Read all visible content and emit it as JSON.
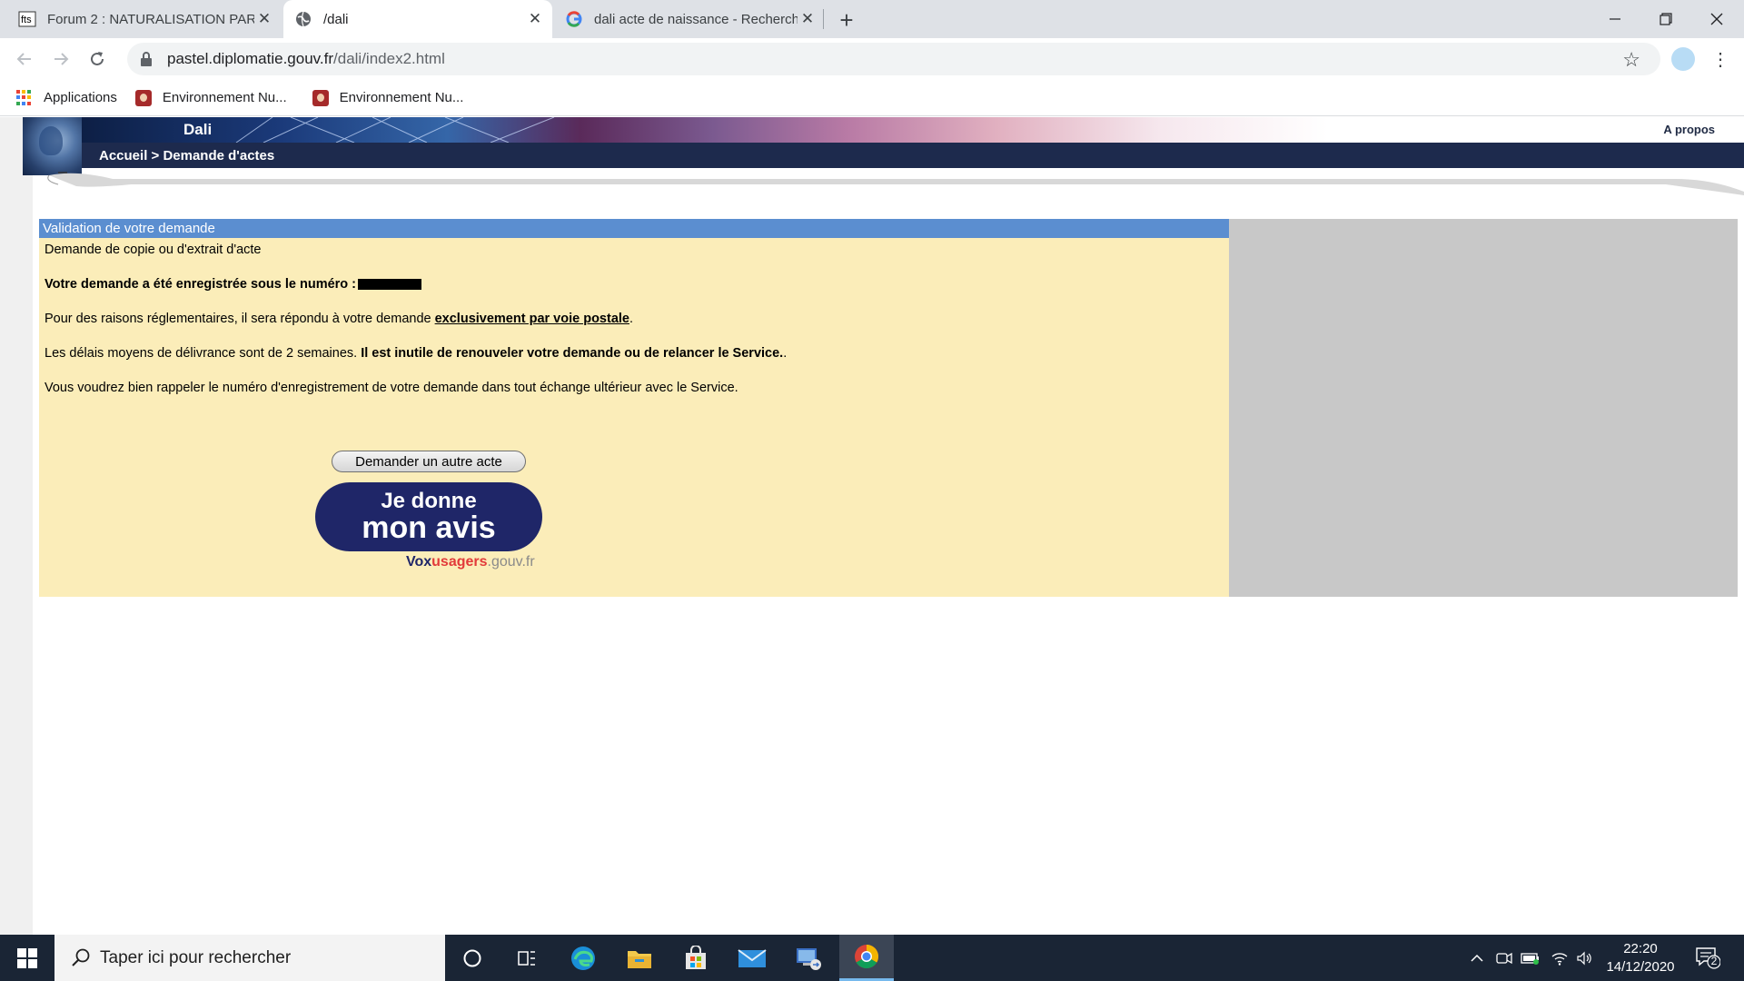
{
  "browser": {
    "tabs": [
      {
        "title": "Forum 2 : NATURALISATION PAR",
        "favicon": "forum-favicon",
        "active": false
      },
      {
        "title": "/dali",
        "favicon": "globe-icon",
        "active": true
      },
      {
        "title": "dali acte de naissance - Recherch",
        "favicon": "google-icon",
        "active": false
      }
    ],
    "url_host": "pastel.diplomatie.gouv.fr",
    "url_path": "/dali/index2.html",
    "bookmarks": [
      {
        "label": "Applications",
        "icon": "apps-grid-icon"
      },
      {
        "label": "Environnement Nu...",
        "icon": "bookmark-icon"
      },
      {
        "label": "Environnement Nu...",
        "icon": "bookmark-icon"
      }
    ]
  },
  "site": {
    "title": "Dali",
    "apropos": "A propos",
    "breadcrumb": "Accueil > Demande d'actes"
  },
  "panel": {
    "header": "Validation de votre demande",
    "line1": "Demande de copie ou d'extrait d'acte",
    "line2": "Votre demande a été enregistrée sous le numéro :",
    "line3_pre": "Pour des raisons réglementaires, il sera répondu à votre demande ",
    "line3_link": "exclusivement par voie postale",
    "line3_post": ".",
    "line4_pre": "Les délais moyens de délivrance sont de 2 semaines. ",
    "line4_bold": "Il est inutile de renouveler votre demande ou de relancer le Service.",
    "line4_post": ".",
    "line5": "Vous voudrez bien rappeler le numéro d'enregistrement de votre demande dans tout échange ultérieur avec le Service.",
    "button": "Demander un autre acte",
    "avis_line1": "Je donne",
    "avis_line2": "mon avis",
    "vox_a": "Vox",
    "vox_b": "usagers",
    "vox_c": ".gouv.fr"
  },
  "taskbar": {
    "search_placeholder": "Taper ici pour rechercher",
    "time": "22:20",
    "date": "14/12/2020",
    "notifications": "2"
  }
}
